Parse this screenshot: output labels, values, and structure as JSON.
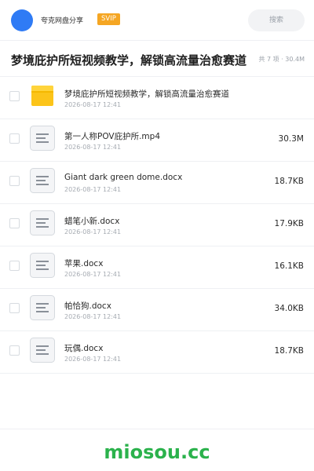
{
  "header": {
    "username": "夸克网盘分享",
    "badge": "SVIP",
    "search_placeholder": "搜索"
  },
  "share": {
    "title": "梦境庇护所短视频教学，解锁高流量治愈赛道",
    "meta": "共 7 项 · 30.4M"
  },
  "files": [
    {
      "name": "梦境庇护所短视频教学，解锁高流量治愈赛道",
      "date": "2026-08-17 12:41",
      "size": "",
      "icon": "folder-icon"
    },
    {
      "name": "第一人称POV庇护所.mp4",
      "date": "2026-08-17 12:41",
      "size": "30.3M",
      "icon": "document-icon"
    },
    {
      "name": "Giant dark green dome.docx",
      "date": "2026-08-17 12:41",
      "size": "18.7KB",
      "icon": "document-icon"
    },
    {
      "name": "蜡笔小新.docx",
      "date": "2026-08-17 12:41",
      "size": "17.9KB",
      "icon": "document-icon"
    },
    {
      "name": "苹果.docx",
      "date": "2026-08-17 12:41",
      "size": "16.1KB",
      "icon": "document-icon"
    },
    {
      "name": "帕恰狗.docx",
      "date": "2026-08-17 12:41",
      "size": "34.0KB",
      "icon": "document-icon"
    },
    {
      "name": "玩偶.docx",
      "date": "2026-08-17 12:41",
      "size": "18.7KB",
      "icon": "document-icon"
    }
  ],
  "footer": {
    "brand": "miosou.cc"
  },
  "colors": {
    "accent": "#2f7bf5",
    "svip": "#f5a623",
    "folder": "#fcc419",
    "brand": "#2bb24c"
  }
}
